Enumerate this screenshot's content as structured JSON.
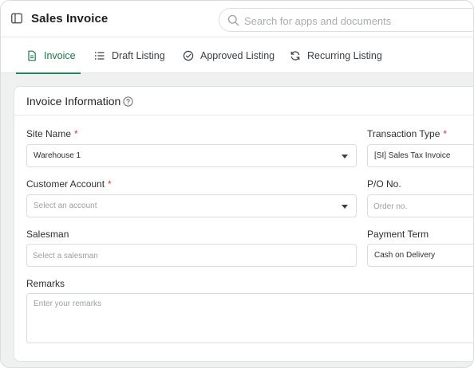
{
  "header": {
    "title": "Sales Invoice",
    "search_placeholder": "Search for apps and documents"
  },
  "tabs": [
    {
      "label": "Invoice",
      "icon": "document-icon",
      "active": true
    },
    {
      "label": "Draft Listing",
      "icon": "list-icon",
      "active": false
    },
    {
      "label": "Approved Listing",
      "icon": "check-circle-icon",
      "active": false
    },
    {
      "label": "Recurring Listing",
      "icon": "refresh-icon",
      "active": false
    }
  ],
  "section": {
    "title": "Invoice Information"
  },
  "form": {
    "site_name": {
      "label": "Site Name",
      "required_mark": "*",
      "value": "Warehouse 1"
    },
    "transaction_type": {
      "label": "Transaction Type",
      "required_mark": "*",
      "value": "[SI] Sales Tax Invoice"
    },
    "customer_account": {
      "label": "Customer Account",
      "required_mark": "*",
      "placeholder": "Select an account"
    },
    "po_no": {
      "label": "P/O No.",
      "placeholder": "Order no."
    },
    "salesman": {
      "label": "Salesman",
      "placeholder": "Select a salesman"
    },
    "payment_term": {
      "label": "Payment Term",
      "value": "Cash on Delivery"
    },
    "remarks": {
      "label": "Remarks",
      "placeholder": "Enter your remarks"
    }
  },
  "colors": {
    "accent": "#1e8a55",
    "required": "#d93636",
    "background": "#eef1f0"
  }
}
